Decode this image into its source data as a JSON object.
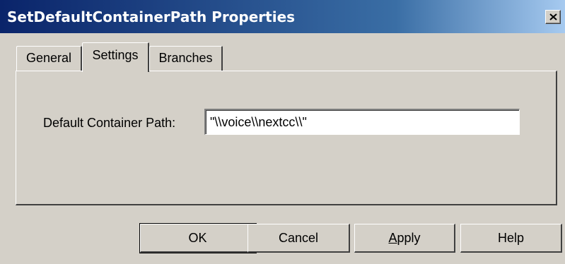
{
  "window": {
    "title": "SetDefaultContainerPath Properties",
    "close_icon": "close-icon"
  },
  "tabs": [
    {
      "label": "General",
      "active": false
    },
    {
      "label": "Settings",
      "active": true
    },
    {
      "label": "Branches",
      "active": false
    }
  ],
  "settings": {
    "path_label": "Default Container Path:",
    "path_value": "\"\\\\voice\\\\nextcc\\\\\""
  },
  "buttons": {
    "ok": "OK",
    "cancel": "Cancel",
    "apply_first": "A",
    "apply_rest": "pply",
    "help": "Help"
  }
}
